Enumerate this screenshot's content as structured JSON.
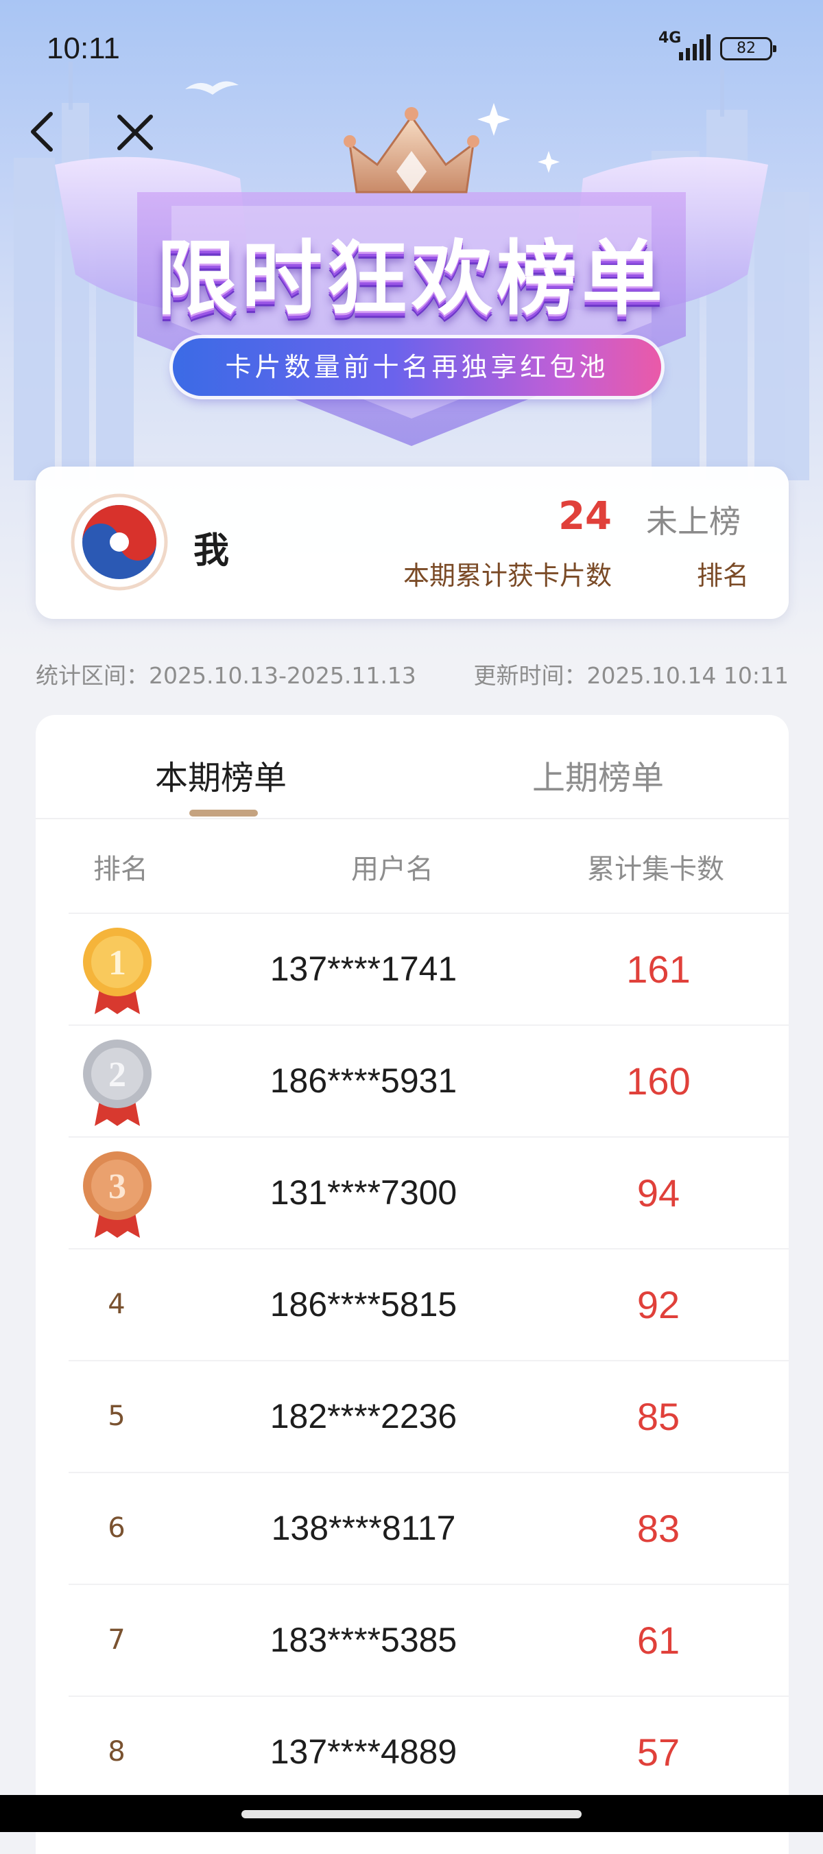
{
  "status": {
    "time": "10:11",
    "network": "4G",
    "battery": "82"
  },
  "banner": {
    "title": "限时狂欢榜单",
    "subtitle": "卡片数量前十名再独享红包池"
  },
  "me": {
    "name": "我",
    "count": "24",
    "count_label": "本期累计获卡片数",
    "rank_status": "未上榜",
    "rank_label": "排名"
  },
  "period": {
    "range": "统计区间：2025.10.13-2025.11.13",
    "updated": "更新时间：2025.10.14 10:11"
  },
  "tabs": {
    "current": "本期榜单",
    "last": "上期榜单"
  },
  "columns": {
    "rank": "排名",
    "user": "用户名",
    "count": "累计集卡数"
  },
  "rows": [
    {
      "rank": "1",
      "user": "137****1741",
      "count": "161"
    },
    {
      "rank": "2",
      "user": "186****5931",
      "count": "160"
    },
    {
      "rank": "3",
      "user": "131****7300",
      "count": "94"
    },
    {
      "rank": "4",
      "user": "186****5815",
      "count": "92"
    },
    {
      "rank": "5",
      "user": "182****2236",
      "count": "85"
    },
    {
      "rank": "6",
      "user": "138****8117",
      "count": "83"
    },
    {
      "rank": "7",
      "user": "183****5385",
      "count": "61"
    },
    {
      "rank": "8",
      "user": "137****4889",
      "count": "57"
    }
  ],
  "medal_colors": {
    "gold": "#f5b43a",
    "silver": "#b9bcc4",
    "bronze": "#de8a52",
    "ribbon": "#d8392f"
  },
  "accent": "#e0403a"
}
